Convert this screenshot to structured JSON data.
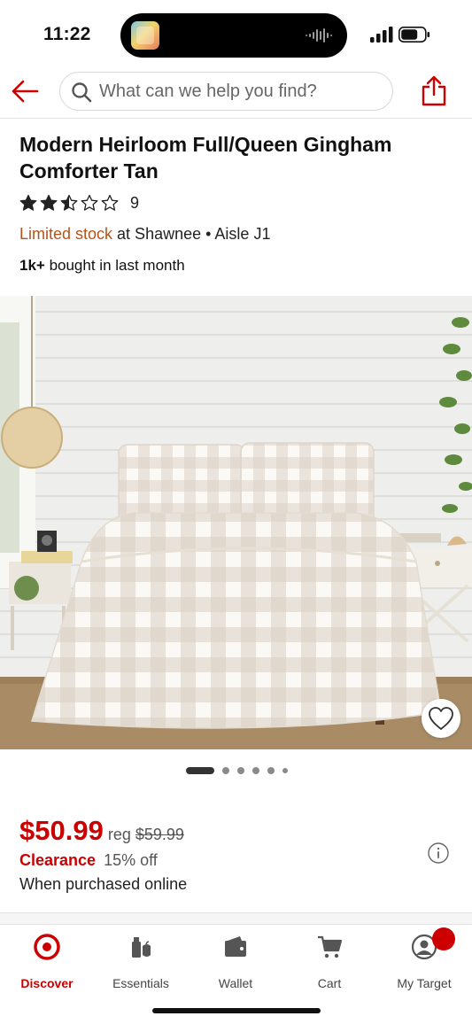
{
  "status_bar": {
    "time": "11:22"
  },
  "search": {
    "placeholder": "What can we help you find?"
  },
  "product": {
    "title": "Modern Heirloom Full/Queen Gingham Comforter Tan",
    "rating_value": 2.5,
    "rating_max": 5,
    "rating_count": "9",
    "stock_status": "Limited stock",
    "stock_location": " at Shawnee • Aisle J1",
    "bought_count": "1k+",
    "bought_text": " bought in last month"
  },
  "carousel": {
    "total_images": 6,
    "active_index": 0
  },
  "pricing": {
    "price": "$50.99",
    "reg_label": "reg",
    "reg_price": "$59.99",
    "clearance_label": "Clearance",
    "discount": "15% off",
    "purchase_note": "When purchased online"
  },
  "tabbar": {
    "tabs": [
      {
        "label": "Discover",
        "icon": "target-logo-icon",
        "active": true
      },
      {
        "label": "Essentials",
        "icon": "essentials-icon",
        "active": false
      },
      {
        "label": "Wallet",
        "icon": "wallet-icon",
        "active": false
      },
      {
        "label": "Cart",
        "icon": "cart-icon",
        "active": false
      },
      {
        "label": "My Target",
        "icon": "profile-icon",
        "active": false
      }
    ]
  },
  "colors": {
    "brand_red": "#cc0000",
    "stock_orange": "#b2541a"
  }
}
